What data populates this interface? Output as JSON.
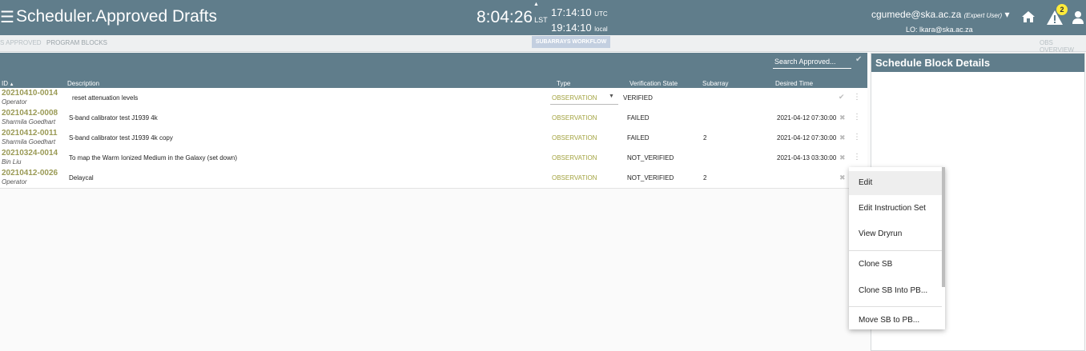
{
  "header": {
    "app_title": "Scheduler.Approved Drafts",
    "lst_time": "8:04:26",
    "lst_label": "LST",
    "utc_time": "17:14:10",
    "utc_label": "UTC",
    "local_time": "19:14:10",
    "local_label": "local",
    "user": "cgumede@ska.ac.za",
    "user_role": "(Expert User)",
    "lo": "LO: lkara@ska.ac.za",
    "notification_count": "2"
  },
  "subnav": {
    "tab_approved": "S APPROVED",
    "tab_program_blocks": "PROGRAM BLOCKS",
    "workflow_button": "SUBARRAYS WORKFLOW",
    "tab_obs_overview": "OBS OVERVIEW"
  },
  "table": {
    "search_placeholder": "Search Approved...",
    "columns": {
      "id": "ID",
      "description": "Description",
      "type": "Type",
      "verification": "Verification State",
      "subarray": "Subarray",
      "desired_time": "Desired Time"
    },
    "rows": [
      {
        "id": "20210410-0014",
        "owner": "Operator",
        "description": "reset attenuation levels",
        "type": "OBSERVATION",
        "verification": "VERIFIED",
        "subarray": "",
        "desired_time": ""
      },
      {
        "id": "20210412-0008",
        "owner": "Sharmila Goedhart",
        "description": "S-band calibrator test J1939 4k",
        "type": "OBSERVATION",
        "verification": "FAILED",
        "subarray": "",
        "desired_time": "2021-04-12 07:30:00"
      },
      {
        "id": "20210412-0011",
        "owner": "Sharmila Goedhart",
        "description": "S-band calibrator test J1939 4k copy",
        "type": "OBSERVATION",
        "verification": "FAILED",
        "subarray": "2",
        "desired_time": "2021-04-12 07:30:00"
      },
      {
        "id": "20210324-0014",
        "owner": "Bin Liu",
        "description": "To map the Warm Ionized Medium in the Galaxy (set down)",
        "type": "OBSERVATION",
        "verification": "NOT_VERIFIED",
        "subarray": "",
        "desired_time": "2021-04-13 03:30:00"
      },
      {
        "id": "20210412-0026",
        "owner": "Operator",
        "description": "Delaycal",
        "type": "OBSERVATION",
        "verification": "NOT_VERIFIED",
        "subarray": "2",
        "desired_time": ""
      }
    ]
  },
  "side_panel": {
    "title": "Schedule Block Details"
  },
  "context_menu": {
    "items": [
      "Edit",
      "Edit Instruction Set",
      "View Dryrun",
      "Clone SB",
      "Clone SB Into PB...",
      "Move SB to PB..."
    ]
  },
  "colors": {
    "header_bg": "#607d8b",
    "id_color": "#9a9a55",
    "type_color": "#a3a340",
    "badge": "#ffeb3b"
  }
}
